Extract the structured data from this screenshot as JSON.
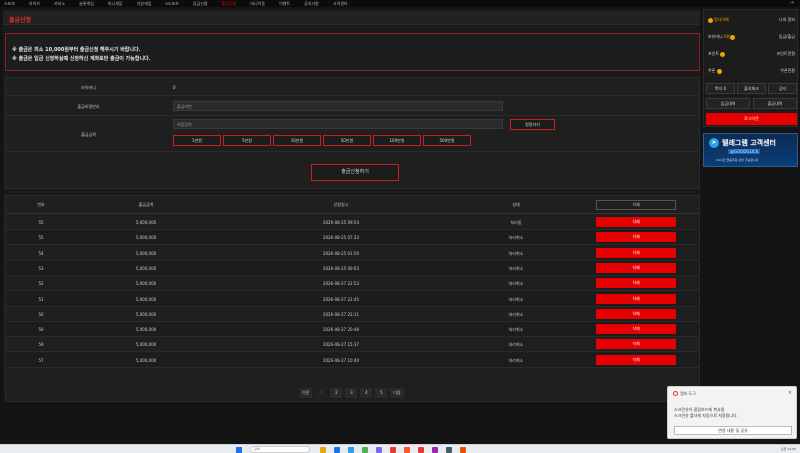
{
  "topnav": {
    "items": [
      "스포츠",
      "라이브",
      "카지노",
      "슬롯게임",
      "미니게임",
      "가상게임",
      "e스포츠",
      "입금신청",
      "출금신청",
      "머니이동",
      "이벤트",
      "공지사항",
      "고객센터"
    ],
    "active_index": 8
  },
  "page": {
    "title": "출금신청"
  },
  "notice": {
    "line1": "※ 출금은 최소 10,000원부터 출금신청 해주시기 바랍니다.",
    "line2": "※ 출금은 입금 신청하실때 신청하신 계좌로만 출금이 가능합니다."
  },
  "form": {
    "balance_label": "보유머니",
    "balance_value": "0",
    "password_label": "출금비밀번호",
    "password_placeholder": "출금비번",
    "amount_label": "출금금액",
    "amount_placeholder": "직접입력",
    "reset_label": "정정하기",
    "amount_buttons": [
      "1만원",
      "5만원",
      "10만원",
      "50만원",
      "100만원",
      "500만원"
    ],
    "submit_label": "출금신청하기"
  },
  "table": {
    "headers": [
      "번호",
      "출금금액",
      "신청일시",
      "상태",
      "삭제"
    ],
    "rows": [
      {
        "no": "55",
        "amount": "5,000,000",
        "date": "2026-08-25 09:54",
        "status": "처리중",
        "action": "삭제"
      },
      {
        "no": "55",
        "amount": "5,000,000",
        "date": "2026-08-25 07:33",
        "status": "처리취소",
        "action": "삭제"
      },
      {
        "no": "54",
        "amount": "5,000,000",
        "date": "2026-08-25 01:50",
        "status": "처리취소",
        "action": "삭제"
      },
      {
        "no": "53",
        "amount": "5,000,000",
        "date": "2026-08-25 00:03",
        "status": "처리취소",
        "action": "삭제"
      },
      {
        "no": "52",
        "amount": "5,000,000",
        "date": "2026-08-27 22:53",
        "status": "처리취소",
        "action": "삭제"
      },
      {
        "no": "51",
        "amount": "5,000,000",
        "date": "2026-08-27 22:45",
        "status": "처리취소",
        "action": "삭제"
      },
      {
        "no": "50",
        "amount": "5,000,000",
        "date": "2026-08-27 22:11",
        "status": "처리취소",
        "action": "삭제"
      },
      {
        "no": "50",
        "amount": "5,000,000",
        "date": "2026-08-27 20:48",
        "status": "처리취소",
        "action": "삭제"
      },
      {
        "no": "59",
        "amount": "5,000,000",
        "date": "2026-08-27 15:37",
        "status": "처리취소",
        "action": "삭제"
      },
      {
        "no": "57",
        "amount": "5,000,000",
        "date": "2026-08-27 10:40",
        "status": "처리취소",
        "action": "삭제"
      }
    ]
  },
  "pager": {
    "prev": "이전",
    "pages": [
      "1",
      "2",
      "3",
      "4",
      "5"
    ],
    "current": "1",
    "next": "다음"
  },
  "sidebar": {
    "user": "럼다야해",
    "mypage": "나의 정보",
    "money_label": "보유머니",
    "money_value": "0원",
    "deposit_withdraw": "입금/출금",
    "point_label": "포인트",
    "point_exchange": "포인트전환",
    "coupon_label": "쿠폰",
    "coupon_exchange": "쿠폰전환",
    "btn_note": "쪽지 0",
    "btn_attendance": "출석체크",
    "btn_notice": "공지",
    "btn_deposit_list": "입금내역",
    "btn_withdraw_list": "출금내역",
    "logout": "로그아웃"
  },
  "banner": {
    "title": "텔레그램 고객센터",
    "handle": "@GOODGLICK",
    "hours": "24시간 연중무휴 상담 가능합니다"
  },
  "popup": {
    "title": "캡처 도구",
    "line1": "스크린샷이 클립보드에 복사됨",
    "line2": "스크린샷 폴더에 자동으로 저장됩니다.",
    "button": "변경 내용 및 공유",
    "close": "×"
  },
  "taskbar": {
    "search_placeholder": "검색",
    "clock": "오전 11:55"
  },
  "colors": {
    "accent_red": "#e60000",
    "border_red": "#c52121",
    "bg": "#141414"
  }
}
